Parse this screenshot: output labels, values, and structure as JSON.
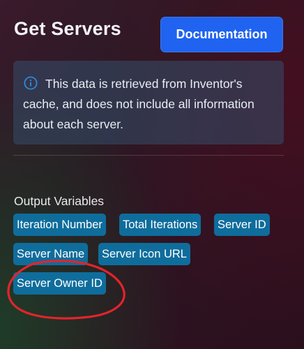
{
  "header": {
    "title": "Get Servers",
    "documentation_button": "Documentation"
  },
  "info": {
    "icon": "info-icon",
    "text": "This data is retrieved from Inventor's cache, and does not include all information about each server.",
    "icon_color": "#2f8ad6"
  },
  "output_variables": {
    "label": "Output Variables",
    "chips": [
      "Iteration Number",
      "Total Iterations",
      "Server ID",
      "Server Name",
      "Server Icon URL",
      "Server Owner ID"
    ]
  },
  "colors": {
    "accent_button": "#1f63f0",
    "chip": "#0f6d9c",
    "annotation_circle": "#e3242b"
  }
}
